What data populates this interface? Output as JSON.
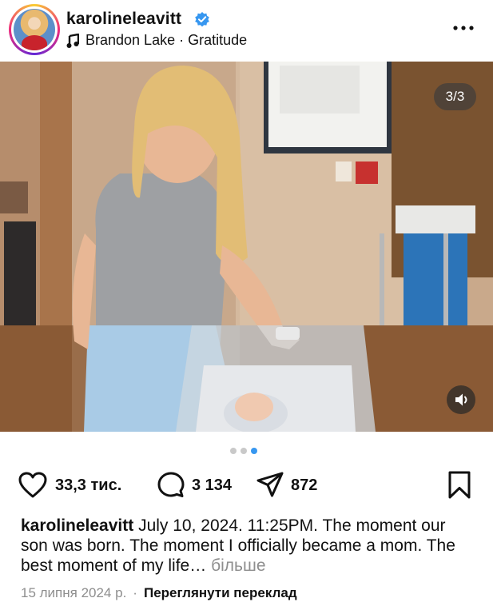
{
  "post": {
    "username": "karolineleavitt",
    "music": "Brandon Lake · Gratitude",
    "counter": "3/3"
  },
  "actions": {
    "likes": "33,3 тис.",
    "comments": "3 134",
    "shares": "872"
  },
  "caption": {
    "user": "karolineleavitt",
    "text": "July 10, 2024. 11:25PM. The moment our son was born. The moment I officially became a mom. The best moment of my life…",
    "more": "більше"
  },
  "meta": {
    "date": "15 липня 2024 р.",
    "separator": "·",
    "translate": "Переглянути переклад"
  },
  "carousel": {
    "count": 3,
    "active": 3
  },
  "colors": {
    "accent": "#3797f0",
    "verified": "#3797f0",
    "muted": "#8e8e8e"
  },
  "icons": [
    "music-note-icon",
    "verified-badge-icon",
    "more-icon",
    "heart-icon",
    "comment-icon",
    "share-icon",
    "bookmark-icon",
    "volume-icon"
  ]
}
